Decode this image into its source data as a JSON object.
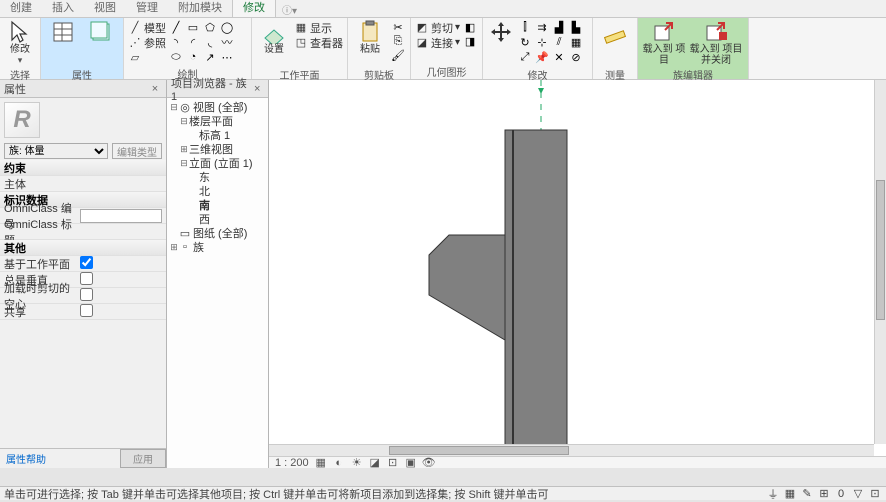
{
  "tabs": [
    "创建",
    "插入",
    "视图",
    "管理",
    "附加模块",
    "修改"
  ],
  "active_tab": "修改",
  "panels": {
    "select": "选择",
    "properties": "属性",
    "clipboard": "剪贴板",
    "draw": "绘制",
    "workplane": "工作平面",
    "geometry": "几何图形",
    "modify": "修改",
    "measure": "测量",
    "fameditor": "族编辑器"
  },
  "btns": {
    "modify": "修改",
    "model": "模型",
    "ref": "参照",
    "show": "显示",
    "set": "设置",
    "viewer": "查看器",
    "paste": "粘贴",
    "cut": "剪切",
    "join": "连接",
    "loadproj": "载入到\n项目",
    "loadclose": "载入到\n项目并关闭"
  },
  "prop": {
    "title": "属性",
    "family": "族: 体量",
    "edit_type": "编辑类型",
    "constraints": "约束",
    "host": "主体",
    "iddata": "标识数据",
    "omni_num": "OmniClass 编号",
    "omni_title": "OmniClass 标题",
    "other": "其他",
    "workplane_based": "基于工作平面",
    "always_vert": "总是垂直",
    "cut_with_voids": "加载时剪切的空心",
    "shared": "共享",
    "help": "属性帮助",
    "apply": "应用"
  },
  "browser": {
    "title": "项目浏览器 - 族1",
    "views_all": "视图 (全部)",
    "floor_plans": "楼层平面",
    "level1": "标高 1",
    "three_d": "三维视图",
    "elev": "立面 (立面 1)",
    "east": "东",
    "north": "北",
    "south": "南",
    "west": "西",
    "sheets": "图纸 (全部)",
    "families": "族"
  },
  "canvas_foot": {
    "scale": "1 : 200"
  },
  "status_text": "单击可进行选择; 按 Tab 键并单击可选择其他项目; 按 Ctrl 键并单击可将新项目添加到选择集; 按 Shift 键并单击可"
}
